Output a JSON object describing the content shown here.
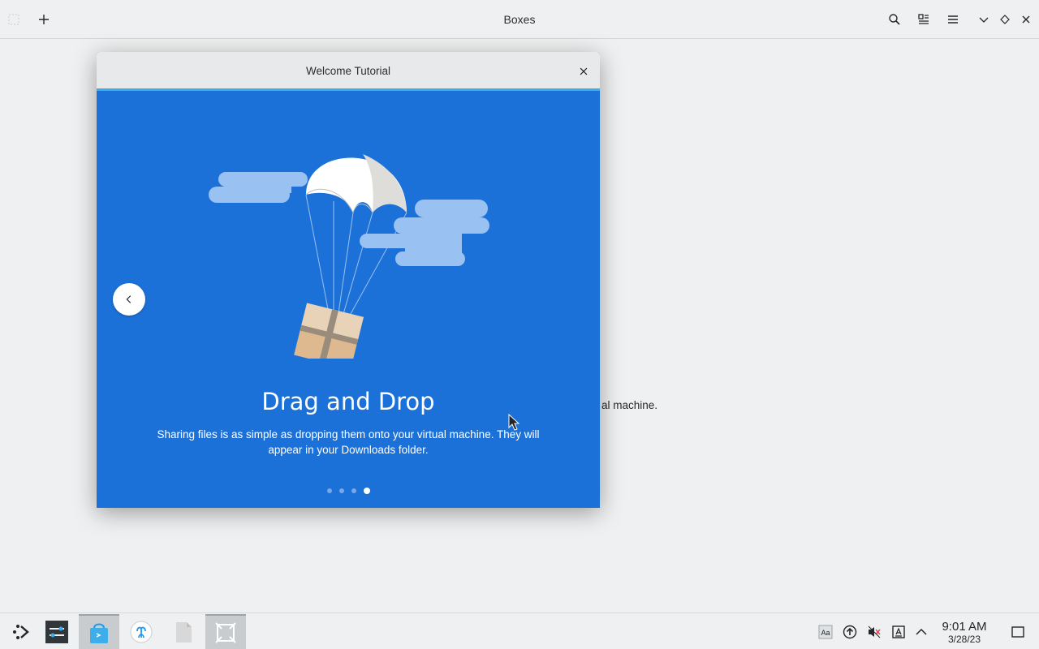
{
  "app": {
    "title": "Boxes",
    "background_text": "al machine."
  },
  "dialog": {
    "title": "Welcome Tutorial",
    "heading": "Drag and Drop",
    "description": "Sharing files is as simple as dropping them onto your virtual machine. They will appear in your Downloads folder.",
    "page_count": 4,
    "active_page": 4
  },
  "taskbar": {
    "time": "9:01 AM",
    "date": "3/28/23"
  },
  "colors": {
    "dialog_background": "#1c71d8",
    "focus_accent": "#3daee9",
    "cloud": "#99c1f1"
  }
}
